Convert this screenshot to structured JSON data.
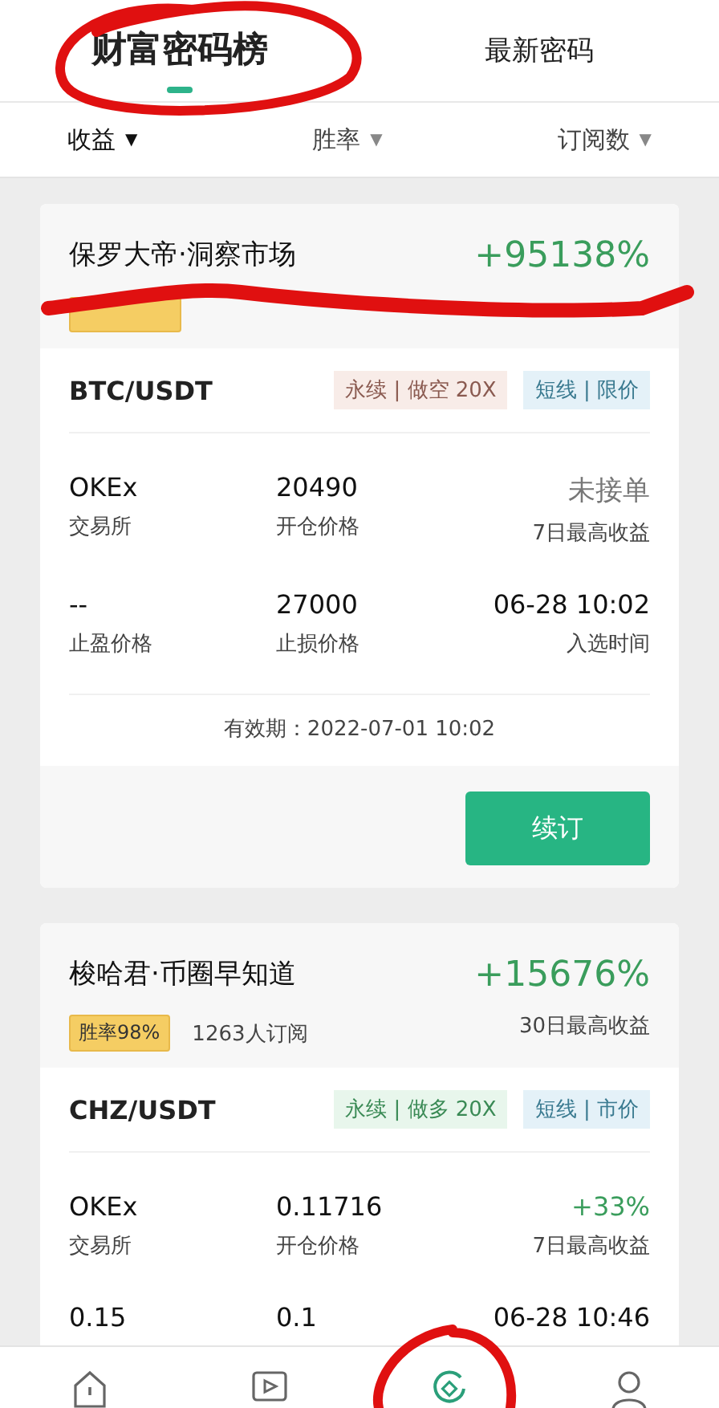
{
  "tabs": [
    {
      "label": "财富密码榜",
      "selected": true
    },
    {
      "label": "最新密码",
      "selected": false
    }
  ],
  "sort_options": [
    {
      "label": "收益",
      "arrow": "▼",
      "selected": true
    },
    {
      "label": "胜率",
      "arrow": "▼",
      "selected": false
    },
    {
      "label": "订阅数",
      "arrow": "▼",
      "selected": false
    }
  ],
  "cards": [
    {
      "name": "保罗大帝·洞察市场",
      "return": "+95138%",
      "covered": true,
      "pair": "BTC/USDT",
      "tags": [
        {
          "text": "永续 | 做空 20X",
          "kind": "short"
        },
        {
          "text": "短线 | 限价",
          "kind": "info"
        }
      ],
      "fields": [
        {
          "value": "OKEx",
          "label": "交易所",
          "kind": "text"
        },
        {
          "value": "20490",
          "label": "开仓价格",
          "kind": "text"
        },
        {
          "value": "未接单",
          "label": "7日最高收益",
          "kind": "muted"
        },
        {
          "value": "--",
          "label": "止盈价格",
          "kind": "text"
        },
        {
          "value": "27000",
          "label": "止损价格",
          "kind": "text"
        },
        {
          "value": "06-28 10:02",
          "label": "入选时间",
          "kind": "text"
        }
      ],
      "validity": "有效期：2022-07-01 10:02",
      "action": "续订"
    },
    {
      "name": "梭哈君·币圈早知道",
      "return": "+15676%",
      "covered": false,
      "win_rate": "胜率98%",
      "subscribers": "1263人订阅",
      "return_label": "30日最高收益",
      "pair": "CHZ/USDT",
      "tags": [
        {
          "text": "永续 | 做多 20X",
          "kind": "long"
        },
        {
          "text": "短线 | 市价",
          "kind": "info"
        }
      ],
      "fields": [
        {
          "value": "OKEx",
          "label": "交易所",
          "kind": "text"
        },
        {
          "value": "0.11716",
          "label": "开仓价格",
          "kind": "text"
        },
        {
          "value": "+33%",
          "label": "7日最高收益",
          "kind": "gain"
        },
        {
          "value": "0.15",
          "kind": "text"
        },
        {
          "value": "0.1",
          "kind": "text"
        },
        {
          "value": "06-28 10:46",
          "kind": "text"
        }
      ]
    }
  ],
  "nav": [
    {
      "kind": "home",
      "selected": false
    },
    {
      "kind": "play",
      "selected": false
    },
    {
      "kind": "target",
      "selected": true
    },
    {
      "kind": "person",
      "selected": false
    }
  ],
  "marker_marks": [
    {
      "kind": "tab-circle"
    },
    {
      "kind": "strike"
    },
    {
      "kind": "nav-circle"
    }
  ]
}
